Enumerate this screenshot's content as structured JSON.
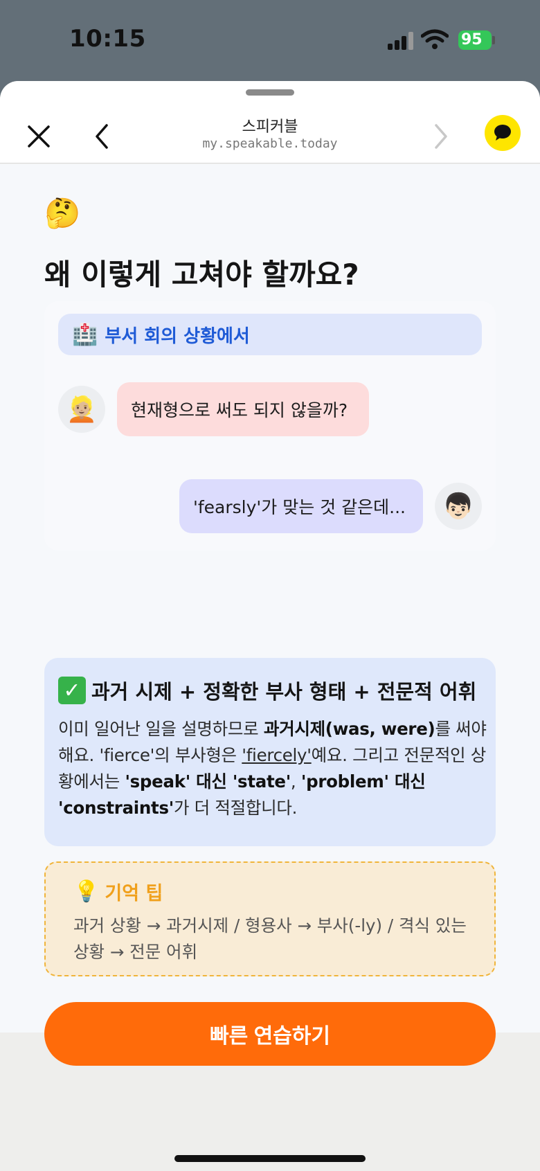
{
  "status_bar": {
    "time": "10:15",
    "battery": "95"
  },
  "browser": {
    "title": "스피커블",
    "url": "my.speakable.today"
  },
  "page": {
    "title_emoji": "🤔",
    "title": "왜 이렇게 고쳐야 할까요?"
  },
  "chat": {
    "context_icon": "🏥",
    "context": "부서 회의 상황에서",
    "left_avatar": "👱🏼",
    "left_message": "현재형으로 써도 되지 않을까?",
    "right_avatar": "👦🏻",
    "right_message": "'fearsly'가 맞는 것 같은데..."
  },
  "explanation": {
    "check_icon": "✓",
    "title": "과거 시제 + 정확한 부사 형태 + 전문적 어휘",
    "body_1": "이미 일어난 일을 설명하므로 ",
    "body_2": "과거시제(was, were)",
    "body_3": "를 써야 해요. 'fierce'의 부사형은 ",
    "body_4": "'fiercely'",
    "body_5": "예요. 그리고 전문적인 상황에서는 ",
    "body_6": "'speak' 대신 'state'",
    "body_7": ", ",
    "body_8": "'problem' 대신 'constraints'",
    "body_9": "가 더 적절합니다."
  },
  "tip": {
    "icon": "💡",
    "title": "기억 팁",
    "body": "과거 상황 → 과거시제 / 형용사 → 부사(-ly) / 격식 있는 상황 → 전문 어휘"
  },
  "actions": {
    "practice_label": "빠른 연습하기"
  },
  "colors": {
    "accent_orange": "#ff6b0a",
    "link_blue": "#1f5bd6",
    "tip_gold": "#f0a01c",
    "kakao_yellow": "#fee500"
  }
}
